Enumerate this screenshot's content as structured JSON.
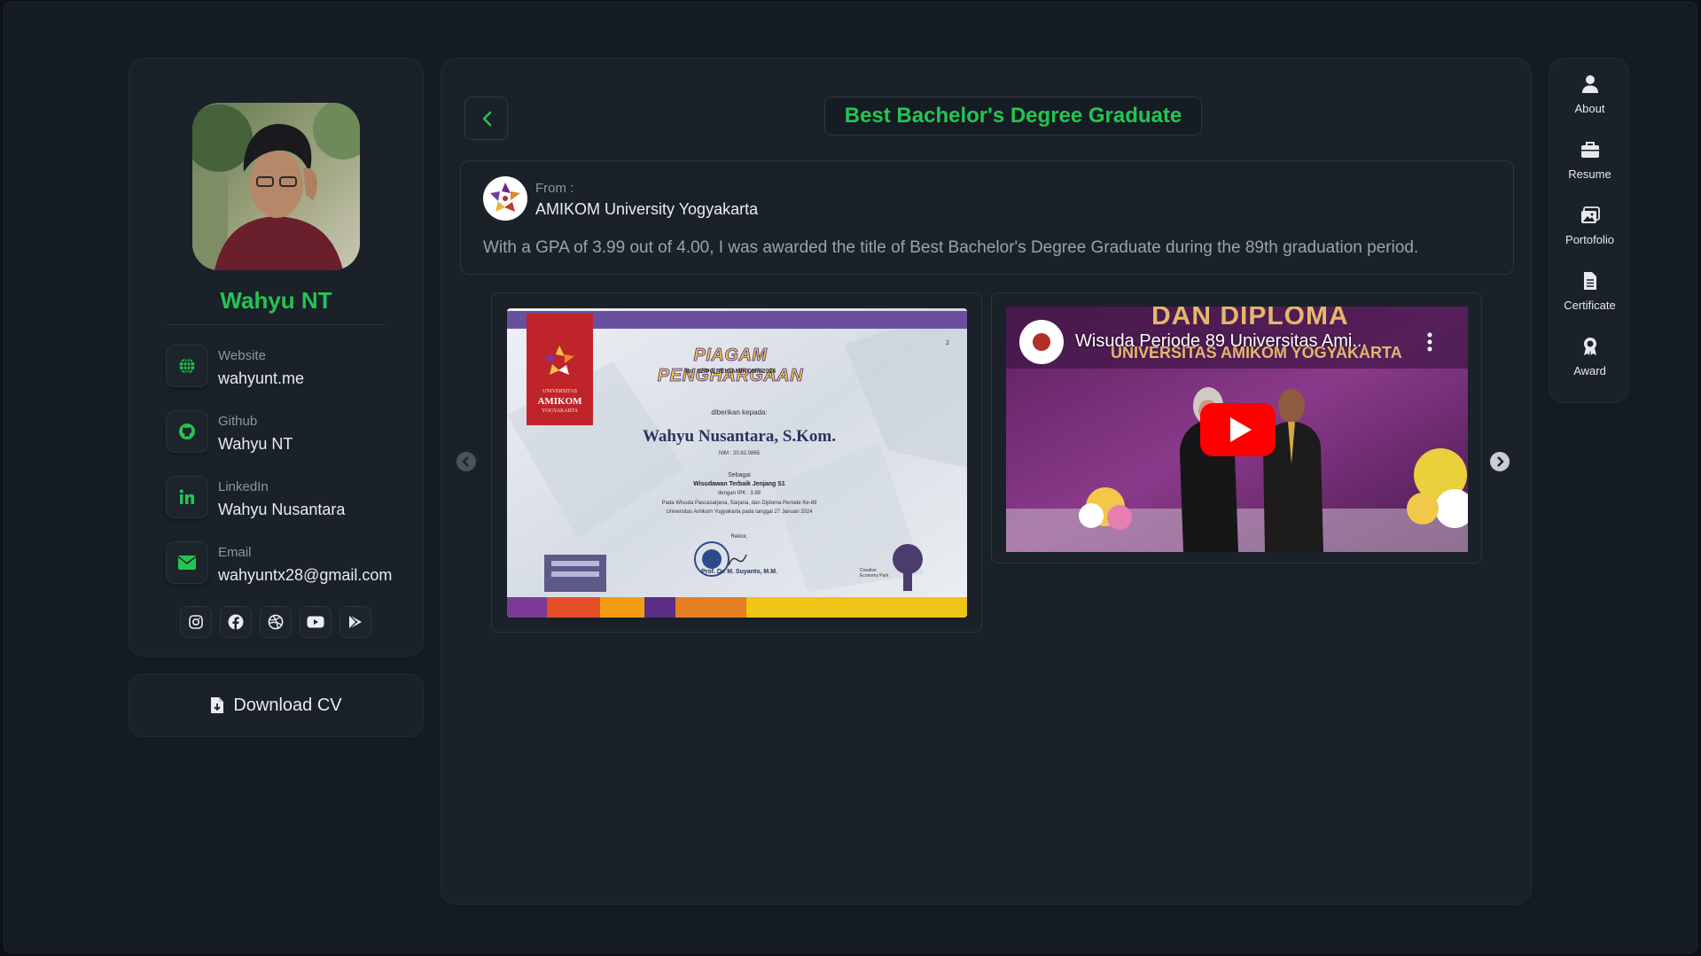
{
  "profile": {
    "name": "Wahyu NT",
    "contacts": [
      {
        "label": "Website",
        "value": "wahyunt.me",
        "icon": "globe-icon"
      },
      {
        "label": "Github",
        "value": "Wahyu NT",
        "icon": "github-icon"
      },
      {
        "label": "LinkedIn",
        "value": "Wahyu Nusantara",
        "icon": "linkedin-icon"
      },
      {
        "label": "Email",
        "value": "wahyuntx28@gmail.com",
        "icon": "envelope-icon"
      }
    ],
    "socials": [
      "instagram-icon",
      "facebook-icon",
      "dribbble-icon",
      "youtube-icon",
      "play-store-icon"
    ],
    "download_label": "Download CV"
  },
  "award": {
    "title": "Best Bachelor's Degree Graduate",
    "from_label": "From :",
    "organization": "AMIKOM University Yogyakarta",
    "description": "With a GPA of 3.99 out of 4.00, I was awarded the title of Best Bachelor's Degree Graduate during the 89th graduation period."
  },
  "certificate": {
    "heading": "PIAGAM PENGHARGAAN",
    "number": "No. 02/PG.REK/AMIKOM/I/2024",
    "given_to": "diberikan kepada:",
    "recipient": "Wahyu Nusantara, S.Kom.",
    "nim": "NIM : 20.82.0865",
    "as": "Sebagai",
    "honor": "Wisudawan Terbaik Jenjang S1",
    "ipk": "dengan IPK : 3.99",
    "line1": "Pada Wisuda Pascasarjana, Sarjana, dan Diploma Periode Ke-89",
    "line2": "Universitas Amikom Yogyakarta pada tanggal 27 Januari 2024",
    "rektor": "Rektor,",
    "signer": "Prof. Dr. M. Suyanto, M.M.",
    "page_no": "2",
    "logo_text1": "UNIVERSITAS",
    "logo_text2": "AMIKOM",
    "logo_text3": "YOGYAKARTA",
    "park_label": "Creative Economy Park"
  },
  "video": {
    "title": "Wisuda Periode 89 Universitas Ami...",
    "banner_top": "DAN DIPLOMA",
    "banner_bottom": "UNIVERSITAS AMIKOM YOGYAKARTA"
  },
  "nav": [
    {
      "label": "About",
      "icon": "user-icon"
    },
    {
      "label": "Resume",
      "icon": "briefcase-icon"
    },
    {
      "label": "Portofolio",
      "icon": "images-icon"
    },
    {
      "label": "Certificate",
      "icon": "file-icon"
    },
    {
      "label": "Award",
      "icon": "award-icon"
    }
  ],
  "colors": {
    "accent": "#23c552",
    "background": "#151b23",
    "card": "#1a2129"
  }
}
